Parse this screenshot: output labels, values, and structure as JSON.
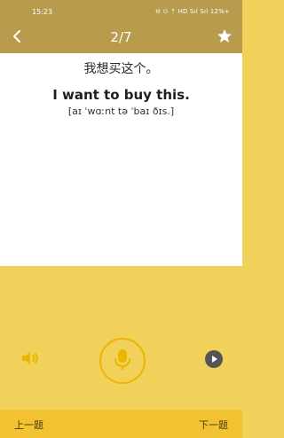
{
  "status": {
    "time": "15:23",
    "icons": "⊖ ⊙ ⇡ HD Sıl Sıl 12%+"
  },
  "header": {
    "title": "2/7"
  },
  "phrase": {
    "chinese": "我想买这个。",
    "english": "I want to buy this.",
    "ipa": "[aɪ ˈwɑːnt tə ˈbaɪ ðɪs.]"
  },
  "nav": {
    "prev": "上一题",
    "next": "下一题"
  },
  "colors": {
    "header_bg": "#b89b4d",
    "accent": "#f2c233",
    "band": "#f2d15a",
    "mic": "#e9b600"
  },
  "icons": {
    "back": "chevron-left-icon",
    "star": "star-icon",
    "speaker": "speaker-icon",
    "mic": "microphone-icon",
    "play": "play-icon"
  }
}
